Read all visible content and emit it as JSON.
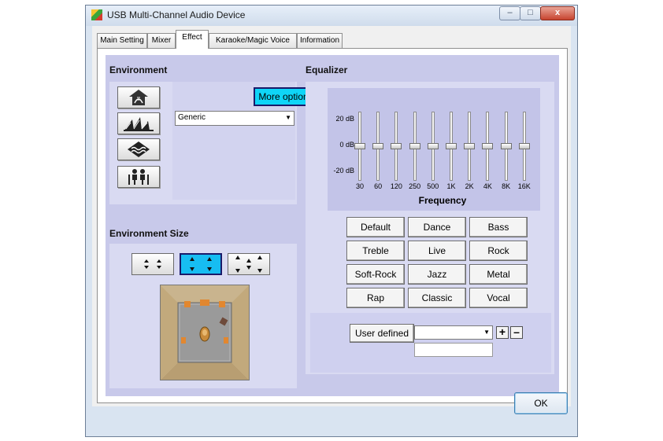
{
  "window": {
    "title": "USB Multi-Channel Audio Device",
    "minimize": "–",
    "maximize": "□",
    "close": "x"
  },
  "tabs": [
    {
      "label": "Main Setting"
    },
    {
      "label": "Mixer"
    },
    {
      "label": "Effect",
      "active": true
    },
    {
      "label": "Karaoke/Magic Voice"
    },
    {
      "label": "Information"
    }
  ],
  "environment": {
    "title": "Environment",
    "buttons": [
      "house-icon",
      "opera-house-icon",
      "water-icon",
      "people-icon"
    ],
    "more_options": "More options",
    "preset_select": "Generic"
  },
  "environment_size": {
    "title": "Environment Size",
    "sizes": [
      {
        "glyph": "⁚⁚",
        "name": "small"
      },
      {
        "glyph": "⁚⁚",
        "name": "medium",
        "active": true
      },
      {
        "glyph": "⁚⁚",
        "name": "large"
      }
    ]
  },
  "equalizer": {
    "title": "Equalizer",
    "db_labels": [
      "20 dB",
      "0 dB",
      "-20 dB"
    ],
    "bands": [
      {
        "freq": "30",
        "level": 0
      },
      {
        "freq": "60",
        "level": 0
      },
      {
        "freq": "120",
        "level": 0
      },
      {
        "freq": "250",
        "level": 0
      },
      {
        "freq": "500",
        "level": 0
      },
      {
        "freq": "1K",
        "level": 0
      },
      {
        "freq": "2K",
        "level": 0
      },
      {
        "freq": "4K",
        "level": 0
      },
      {
        "freq": "8K",
        "level": 0
      },
      {
        "freq": "16K",
        "level": 0
      }
    ],
    "frequency_label": "Frequency",
    "presets": [
      "Default",
      "Dance",
      "Bass",
      "Treble",
      "Live",
      "Rock",
      "Soft-Rock",
      "Jazz",
      "Metal",
      "Rap",
      "Classic",
      "Vocal"
    ],
    "user_defined": "User defined",
    "user_select": "",
    "user_name": "",
    "add": "+",
    "remove": "–"
  },
  "footer": {
    "ok": "OK"
  }
}
